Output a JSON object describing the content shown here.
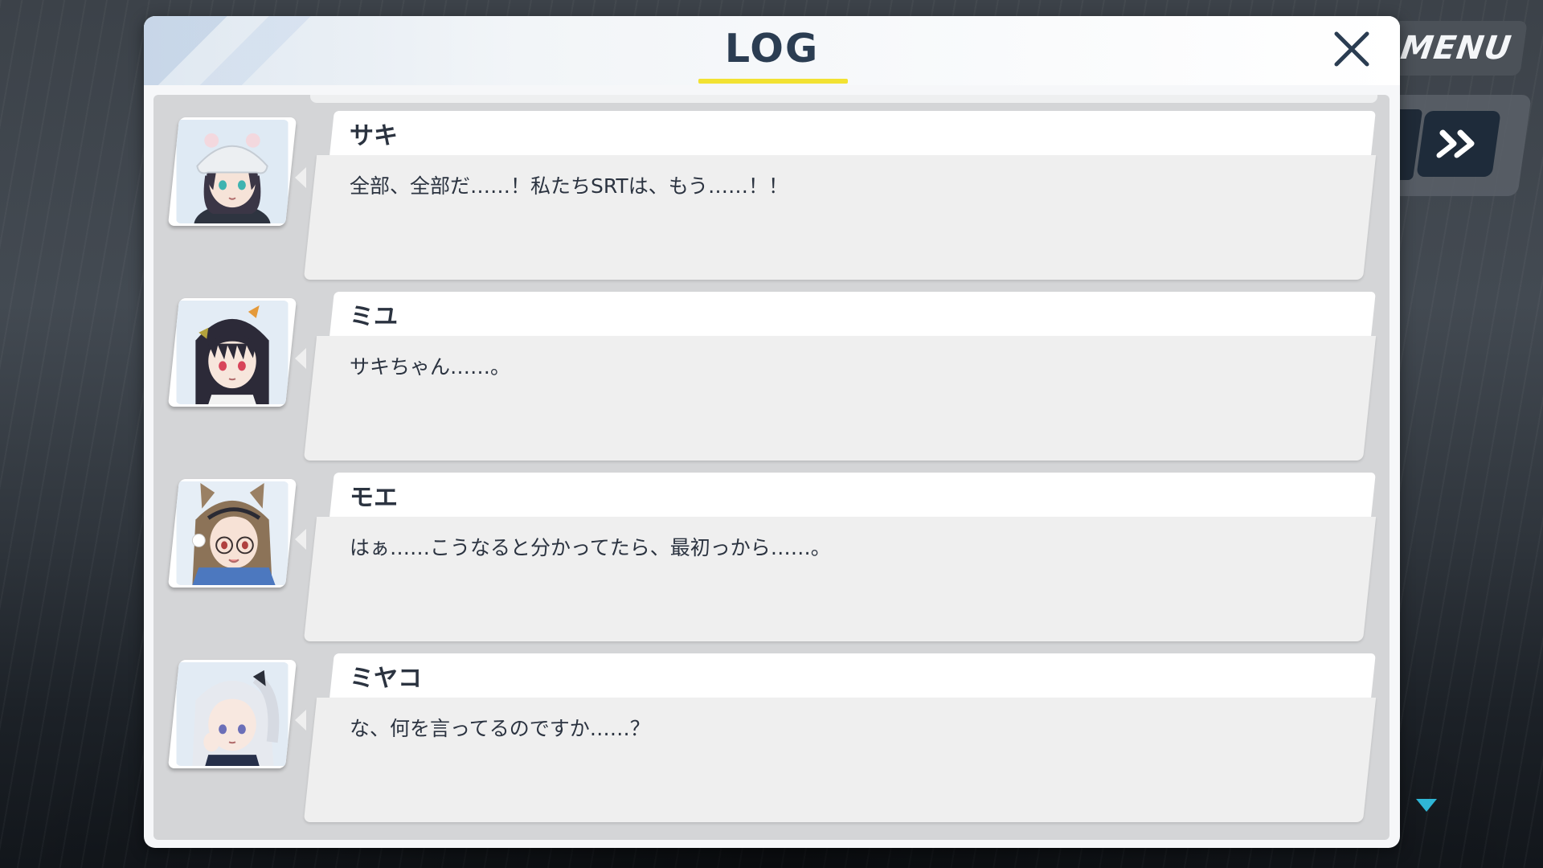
{
  "hud": {
    "menu_label": "MENU",
    "fastforward_icon": "double-chevron-right-icon",
    "scroll_down_icon": "triangle-down-icon"
  },
  "log": {
    "title": "LOG",
    "close_icon": "close-icon",
    "entries": [
      {
        "name": "サキ",
        "text": "全部、全部だ……！私たちSRTは、もう……！！",
        "avatar": "saki-portrait"
      },
      {
        "name": "ミユ",
        "text": "サキちゃん……。",
        "avatar": "miyu-portrait"
      },
      {
        "name": "モエ",
        "text": "はぁ……こうなると分かってたら、最初っから……。",
        "avatar": "moe-portrait"
      },
      {
        "name": "ミヤコ",
        "text": "な、何を言ってるのですか……？",
        "avatar": "miyako-portrait"
      }
    ]
  },
  "colors": {
    "accent_underline": "#f2e232",
    "title_text": "#2b3d52",
    "fastforward_bg": "#1e2b3a",
    "scroll_indicator": "#2fb6d6"
  }
}
